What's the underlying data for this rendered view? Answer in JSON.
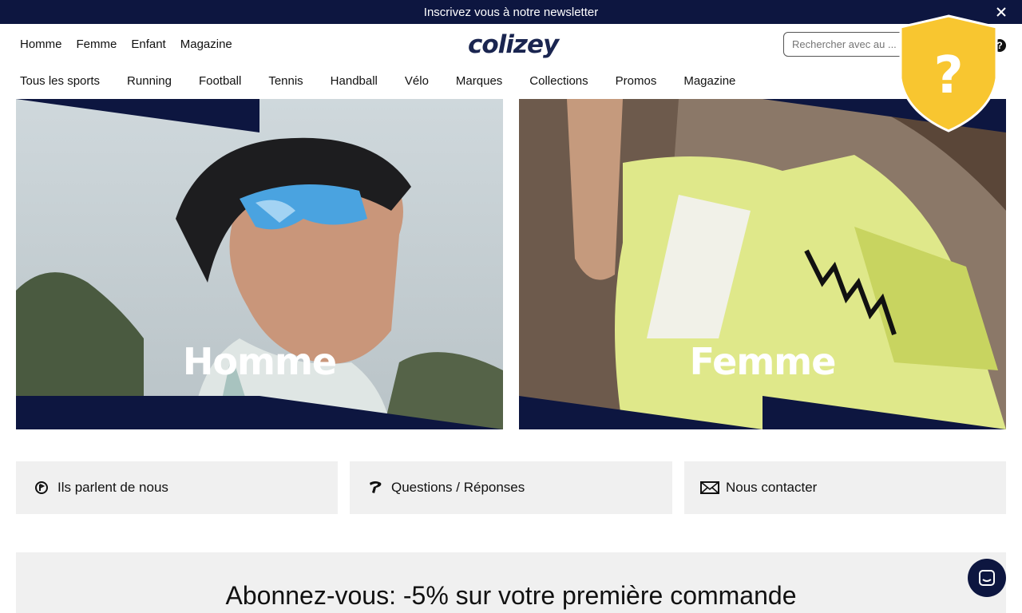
{
  "announcement": {
    "text": "Inscrivez vous à notre newsletter"
  },
  "header": {
    "gender_nav": [
      "Homme",
      "Femme",
      "Enfant",
      "Magazine"
    ],
    "logo": "colizey",
    "search_placeholder": "Rechercher avec au ...",
    "help_mark": "?"
  },
  "sport_nav": [
    "Tous les sports",
    "Running",
    "Football",
    "Tennis",
    "Handball",
    "Vélo",
    "Marques",
    "Collections",
    "Promos",
    "Magazine"
  ],
  "cards": [
    {
      "title": "Homme"
    },
    {
      "title": "Femme"
    }
  ],
  "info_tiles": [
    {
      "label": "Ils parlent de nous",
      "icon": "press-icon"
    },
    {
      "label": "Questions / Réponses",
      "icon": "question-icon"
    },
    {
      "label": "Nous contacter",
      "icon": "mail-icon"
    }
  ],
  "newsletter": {
    "heading": "Abonnez-vous: -5% sur votre première commande"
  },
  "colors": {
    "navy": "#0d1640",
    "shield_yellow": "#f8c630",
    "tile_bg": "#f0f0f0"
  }
}
